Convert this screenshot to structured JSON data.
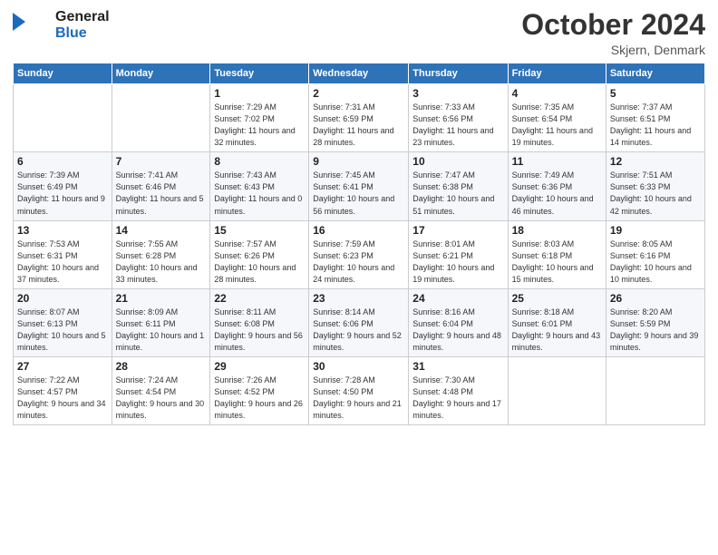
{
  "header": {
    "logo_line1": "General",
    "logo_line2": "Blue",
    "month": "October 2024",
    "location": "Skjern, Denmark"
  },
  "weekdays": [
    "Sunday",
    "Monday",
    "Tuesday",
    "Wednesday",
    "Thursday",
    "Friday",
    "Saturday"
  ],
  "weeks": [
    [
      {
        "day": "",
        "sunrise": "",
        "sunset": "",
        "daylight": ""
      },
      {
        "day": "",
        "sunrise": "",
        "sunset": "",
        "daylight": ""
      },
      {
        "day": "1",
        "sunrise": "Sunrise: 7:29 AM",
        "sunset": "Sunset: 7:02 PM",
        "daylight": "Daylight: 11 hours and 32 minutes."
      },
      {
        "day": "2",
        "sunrise": "Sunrise: 7:31 AM",
        "sunset": "Sunset: 6:59 PM",
        "daylight": "Daylight: 11 hours and 28 minutes."
      },
      {
        "day": "3",
        "sunrise": "Sunrise: 7:33 AM",
        "sunset": "Sunset: 6:56 PM",
        "daylight": "Daylight: 11 hours and 23 minutes."
      },
      {
        "day": "4",
        "sunrise": "Sunrise: 7:35 AM",
        "sunset": "Sunset: 6:54 PM",
        "daylight": "Daylight: 11 hours and 19 minutes."
      },
      {
        "day": "5",
        "sunrise": "Sunrise: 7:37 AM",
        "sunset": "Sunset: 6:51 PM",
        "daylight": "Daylight: 11 hours and 14 minutes."
      }
    ],
    [
      {
        "day": "6",
        "sunrise": "Sunrise: 7:39 AM",
        "sunset": "Sunset: 6:49 PM",
        "daylight": "Daylight: 11 hours and 9 minutes."
      },
      {
        "day": "7",
        "sunrise": "Sunrise: 7:41 AM",
        "sunset": "Sunset: 6:46 PM",
        "daylight": "Daylight: 11 hours and 5 minutes."
      },
      {
        "day": "8",
        "sunrise": "Sunrise: 7:43 AM",
        "sunset": "Sunset: 6:43 PM",
        "daylight": "Daylight: 11 hours and 0 minutes."
      },
      {
        "day": "9",
        "sunrise": "Sunrise: 7:45 AM",
        "sunset": "Sunset: 6:41 PM",
        "daylight": "Daylight: 10 hours and 56 minutes."
      },
      {
        "day": "10",
        "sunrise": "Sunrise: 7:47 AM",
        "sunset": "Sunset: 6:38 PM",
        "daylight": "Daylight: 10 hours and 51 minutes."
      },
      {
        "day": "11",
        "sunrise": "Sunrise: 7:49 AM",
        "sunset": "Sunset: 6:36 PM",
        "daylight": "Daylight: 10 hours and 46 minutes."
      },
      {
        "day": "12",
        "sunrise": "Sunrise: 7:51 AM",
        "sunset": "Sunset: 6:33 PM",
        "daylight": "Daylight: 10 hours and 42 minutes."
      }
    ],
    [
      {
        "day": "13",
        "sunrise": "Sunrise: 7:53 AM",
        "sunset": "Sunset: 6:31 PM",
        "daylight": "Daylight: 10 hours and 37 minutes."
      },
      {
        "day": "14",
        "sunrise": "Sunrise: 7:55 AM",
        "sunset": "Sunset: 6:28 PM",
        "daylight": "Daylight: 10 hours and 33 minutes."
      },
      {
        "day": "15",
        "sunrise": "Sunrise: 7:57 AM",
        "sunset": "Sunset: 6:26 PM",
        "daylight": "Daylight: 10 hours and 28 minutes."
      },
      {
        "day": "16",
        "sunrise": "Sunrise: 7:59 AM",
        "sunset": "Sunset: 6:23 PM",
        "daylight": "Daylight: 10 hours and 24 minutes."
      },
      {
        "day": "17",
        "sunrise": "Sunrise: 8:01 AM",
        "sunset": "Sunset: 6:21 PM",
        "daylight": "Daylight: 10 hours and 19 minutes."
      },
      {
        "day": "18",
        "sunrise": "Sunrise: 8:03 AM",
        "sunset": "Sunset: 6:18 PM",
        "daylight": "Daylight: 10 hours and 15 minutes."
      },
      {
        "day": "19",
        "sunrise": "Sunrise: 8:05 AM",
        "sunset": "Sunset: 6:16 PM",
        "daylight": "Daylight: 10 hours and 10 minutes."
      }
    ],
    [
      {
        "day": "20",
        "sunrise": "Sunrise: 8:07 AM",
        "sunset": "Sunset: 6:13 PM",
        "daylight": "Daylight: 10 hours and 5 minutes."
      },
      {
        "day": "21",
        "sunrise": "Sunrise: 8:09 AM",
        "sunset": "Sunset: 6:11 PM",
        "daylight": "Daylight: 10 hours and 1 minute."
      },
      {
        "day": "22",
        "sunrise": "Sunrise: 8:11 AM",
        "sunset": "Sunset: 6:08 PM",
        "daylight": "Daylight: 9 hours and 56 minutes."
      },
      {
        "day": "23",
        "sunrise": "Sunrise: 8:14 AM",
        "sunset": "Sunset: 6:06 PM",
        "daylight": "Daylight: 9 hours and 52 minutes."
      },
      {
        "day": "24",
        "sunrise": "Sunrise: 8:16 AM",
        "sunset": "Sunset: 6:04 PM",
        "daylight": "Daylight: 9 hours and 48 minutes."
      },
      {
        "day": "25",
        "sunrise": "Sunrise: 8:18 AM",
        "sunset": "Sunset: 6:01 PM",
        "daylight": "Daylight: 9 hours and 43 minutes."
      },
      {
        "day": "26",
        "sunrise": "Sunrise: 8:20 AM",
        "sunset": "Sunset: 5:59 PM",
        "daylight": "Daylight: 9 hours and 39 minutes."
      }
    ],
    [
      {
        "day": "27",
        "sunrise": "Sunrise: 7:22 AM",
        "sunset": "Sunset: 4:57 PM",
        "daylight": "Daylight: 9 hours and 34 minutes."
      },
      {
        "day": "28",
        "sunrise": "Sunrise: 7:24 AM",
        "sunset": "Sunset: 4:54 PM",
        "daylight": "Daylight: 9 hours and 30 minutes."
      },
      {
        "day": "29",
        "sunrise": "Sunrise: 7:26 AM",
        "sunset": "Sunset: 4:52 PM",
        "daylight": "Daylight: 9 hours and 26 minutes."
      },
      {
        "day": "30",
        "sunrise": "Sunrise: 7:28 AM",
        "sunset": "Sunset: 4:50 PM",
        "daylight": "Daylight: 9 hours and 21 minutes."
      },
      {
        "day": "31",
        "sunrise": "Sunrise: 7:30 AM",
        "sunset": "Sunset: 4:48 PM",
        "daylight": "Daylight: 9 hours and 17 minutes."
      },
      {
        "day": "",
        "sunrise": "",
        "sunset": "",
        "daylight": ""
      },
      {
        "day": "",
        "sunrise": "",
        "sunset": "",
        "daylight": ""
      }
    ]
  ]
}
